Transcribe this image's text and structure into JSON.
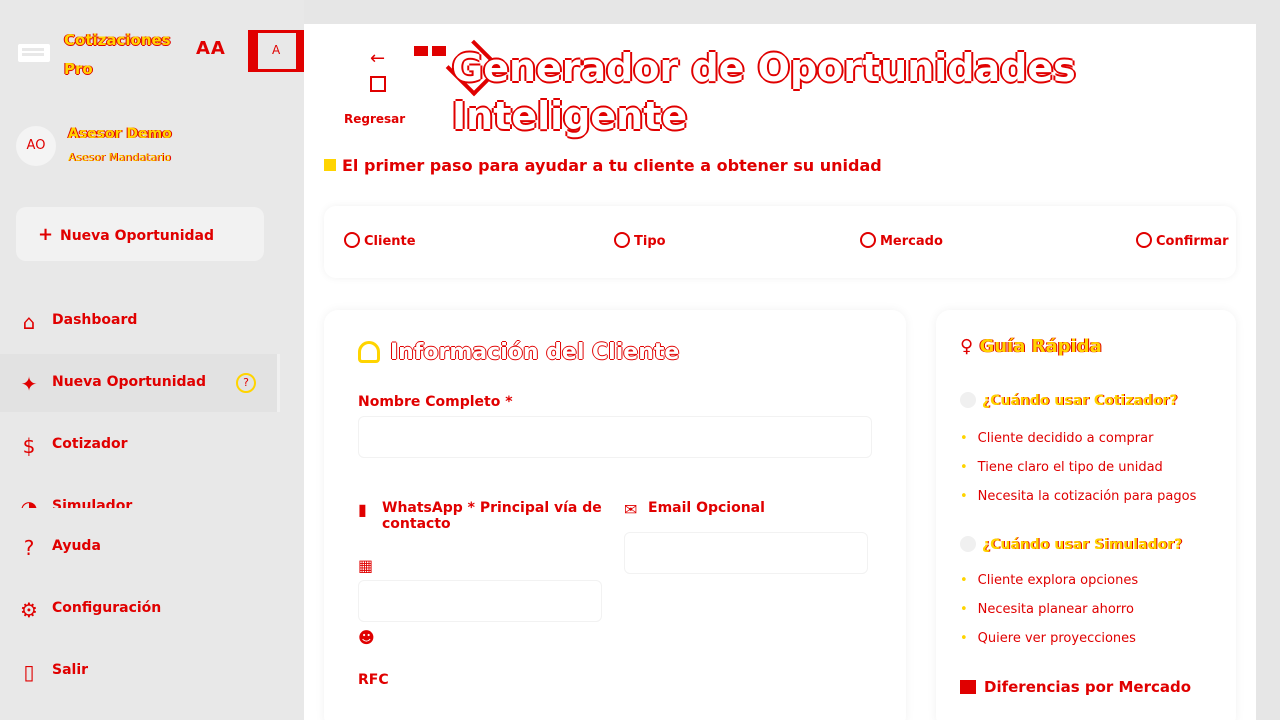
{
  "brand": {
    "name_line1": "Cotizaciones",
    "name_line2": "Pro",
    "font_toggle": "AA",
    "lang_flag": "A"
  },
  "user": {
    "initials": "AO",
    "name": "Asesor Demo",
    "role": "Asesor Mandatario"
  },
  "sidebar": {
    "new_button": "Nueva Oportunidad",
    "items": [
      {
        "label": "Dashboard",
        "icon": "home-icon"
      },
      {
        "label": "Nueva Oportunidad",
        "icon": "sparkle-icon",
        "badge": "?"
      },
      {
        "label": "Cotizador",
        "icon": "money-icon"
      },
      {
        "label": "Simulador",
        "icon": "chart-icon"
      },
      {
        "label": "Ayuda",
        "icon": "help-icon"
      },
      {
        "label": "Configuración",
        "icon": "gear-icon"
      },
      {
        "label": "Salir",
        "icon": "exit-icon"
      }
    ]
  },
  "header": {
    "back_label": "Regresar",
    "title": "Generador de Oportunidades Inteligente",
    "subtitle": "El primer paso para ayudar a tu cliente a obtener su unidad"
  },
  "steps": [
    {
      "label": "Cliente"
    },
    {
      "label": "Tipo"
    },
    {
      "label": "Mercado"
    },
    {
      "label": "Confirmar"
    }
  ],
  "client_card": {
    "title": "Información del Cliente",
    "name_label": "Nombre Completo *",
    "name_value": "",
    "whatsapp_label": "WhatsApp * Principal vía de contacto",
    "whatsapp_value": "",
    "email_label": "Email Opcional",
    "email_value": "",
    "rfc_label": "RFC"
  },
  "guide": {
    "title": "Guía Rápida",
    "q1": "¿Cuándo usar Cotizador?",
    "q1_items": [
      "Cliente decidido a comprar",
      "Tiene claro el tipo de unidad",
      "Necesita la cotización para pagos"
    ],
    "q2": "¿Cuándo usar Simulador?",
    "q2_items": [
      "Cliente explora opciones",
      "Necesita planear ahorro",
      "Quiere ver proyecciones"
    ],
    "footer": "Diferencias por Mercado"
  },
  "colors": {
    "accent": "#e00000",
    "highlight": "#ffd400",
    "panel": "#ffffff",
    "sidebar": "#e8e8e8"
  }
}
